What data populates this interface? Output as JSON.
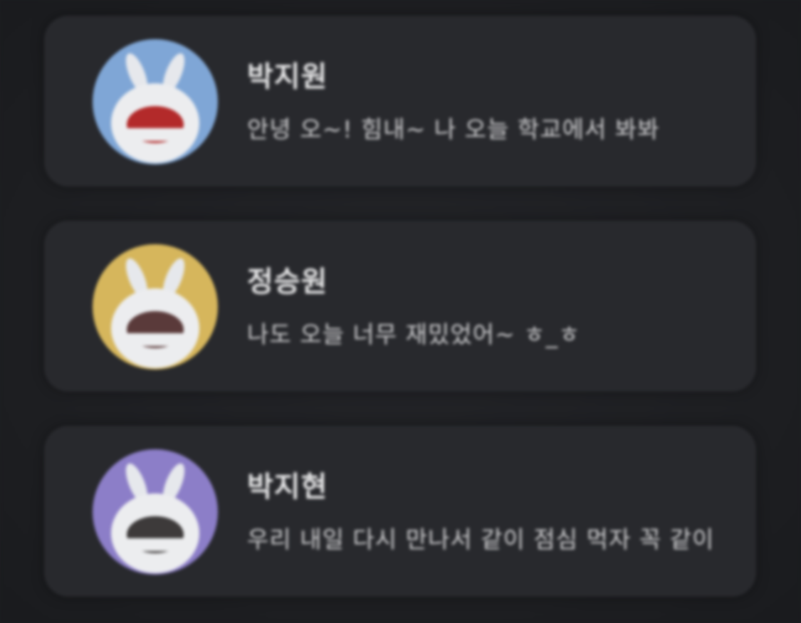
{
  "chats": [
    {
      "name": "박지원",
      "message": "안녕 오~! 힘내~ 나 오늘 학교에서 봐봐",
      "avatar_icon": "bunny-avatar-icon",
      "avatar_color": "#7fa6d6",
      "mouth_color": "#b32a2a"
    },
    {
      "name": "정승원",
      "message": "나도 오늘 너무 재밌었어~ ㅎ_ㅎ",
      "avatar_icon": "bunny-avatar-icon",
      "avatar_color": "#d6b65c",
      "mouth_color": "#5a3a3a"
    },
    {
      "name": "박지현",
      "message": "우리 내일 다시 만나서 같이 점심 먹자 꼭 같이",
      "avatar_icon": "bunny-avatar-icon",
      "avatar_color": "#8c7ec8",
      "mouth_color": "#3d3a3a"
    }
  ]
}
